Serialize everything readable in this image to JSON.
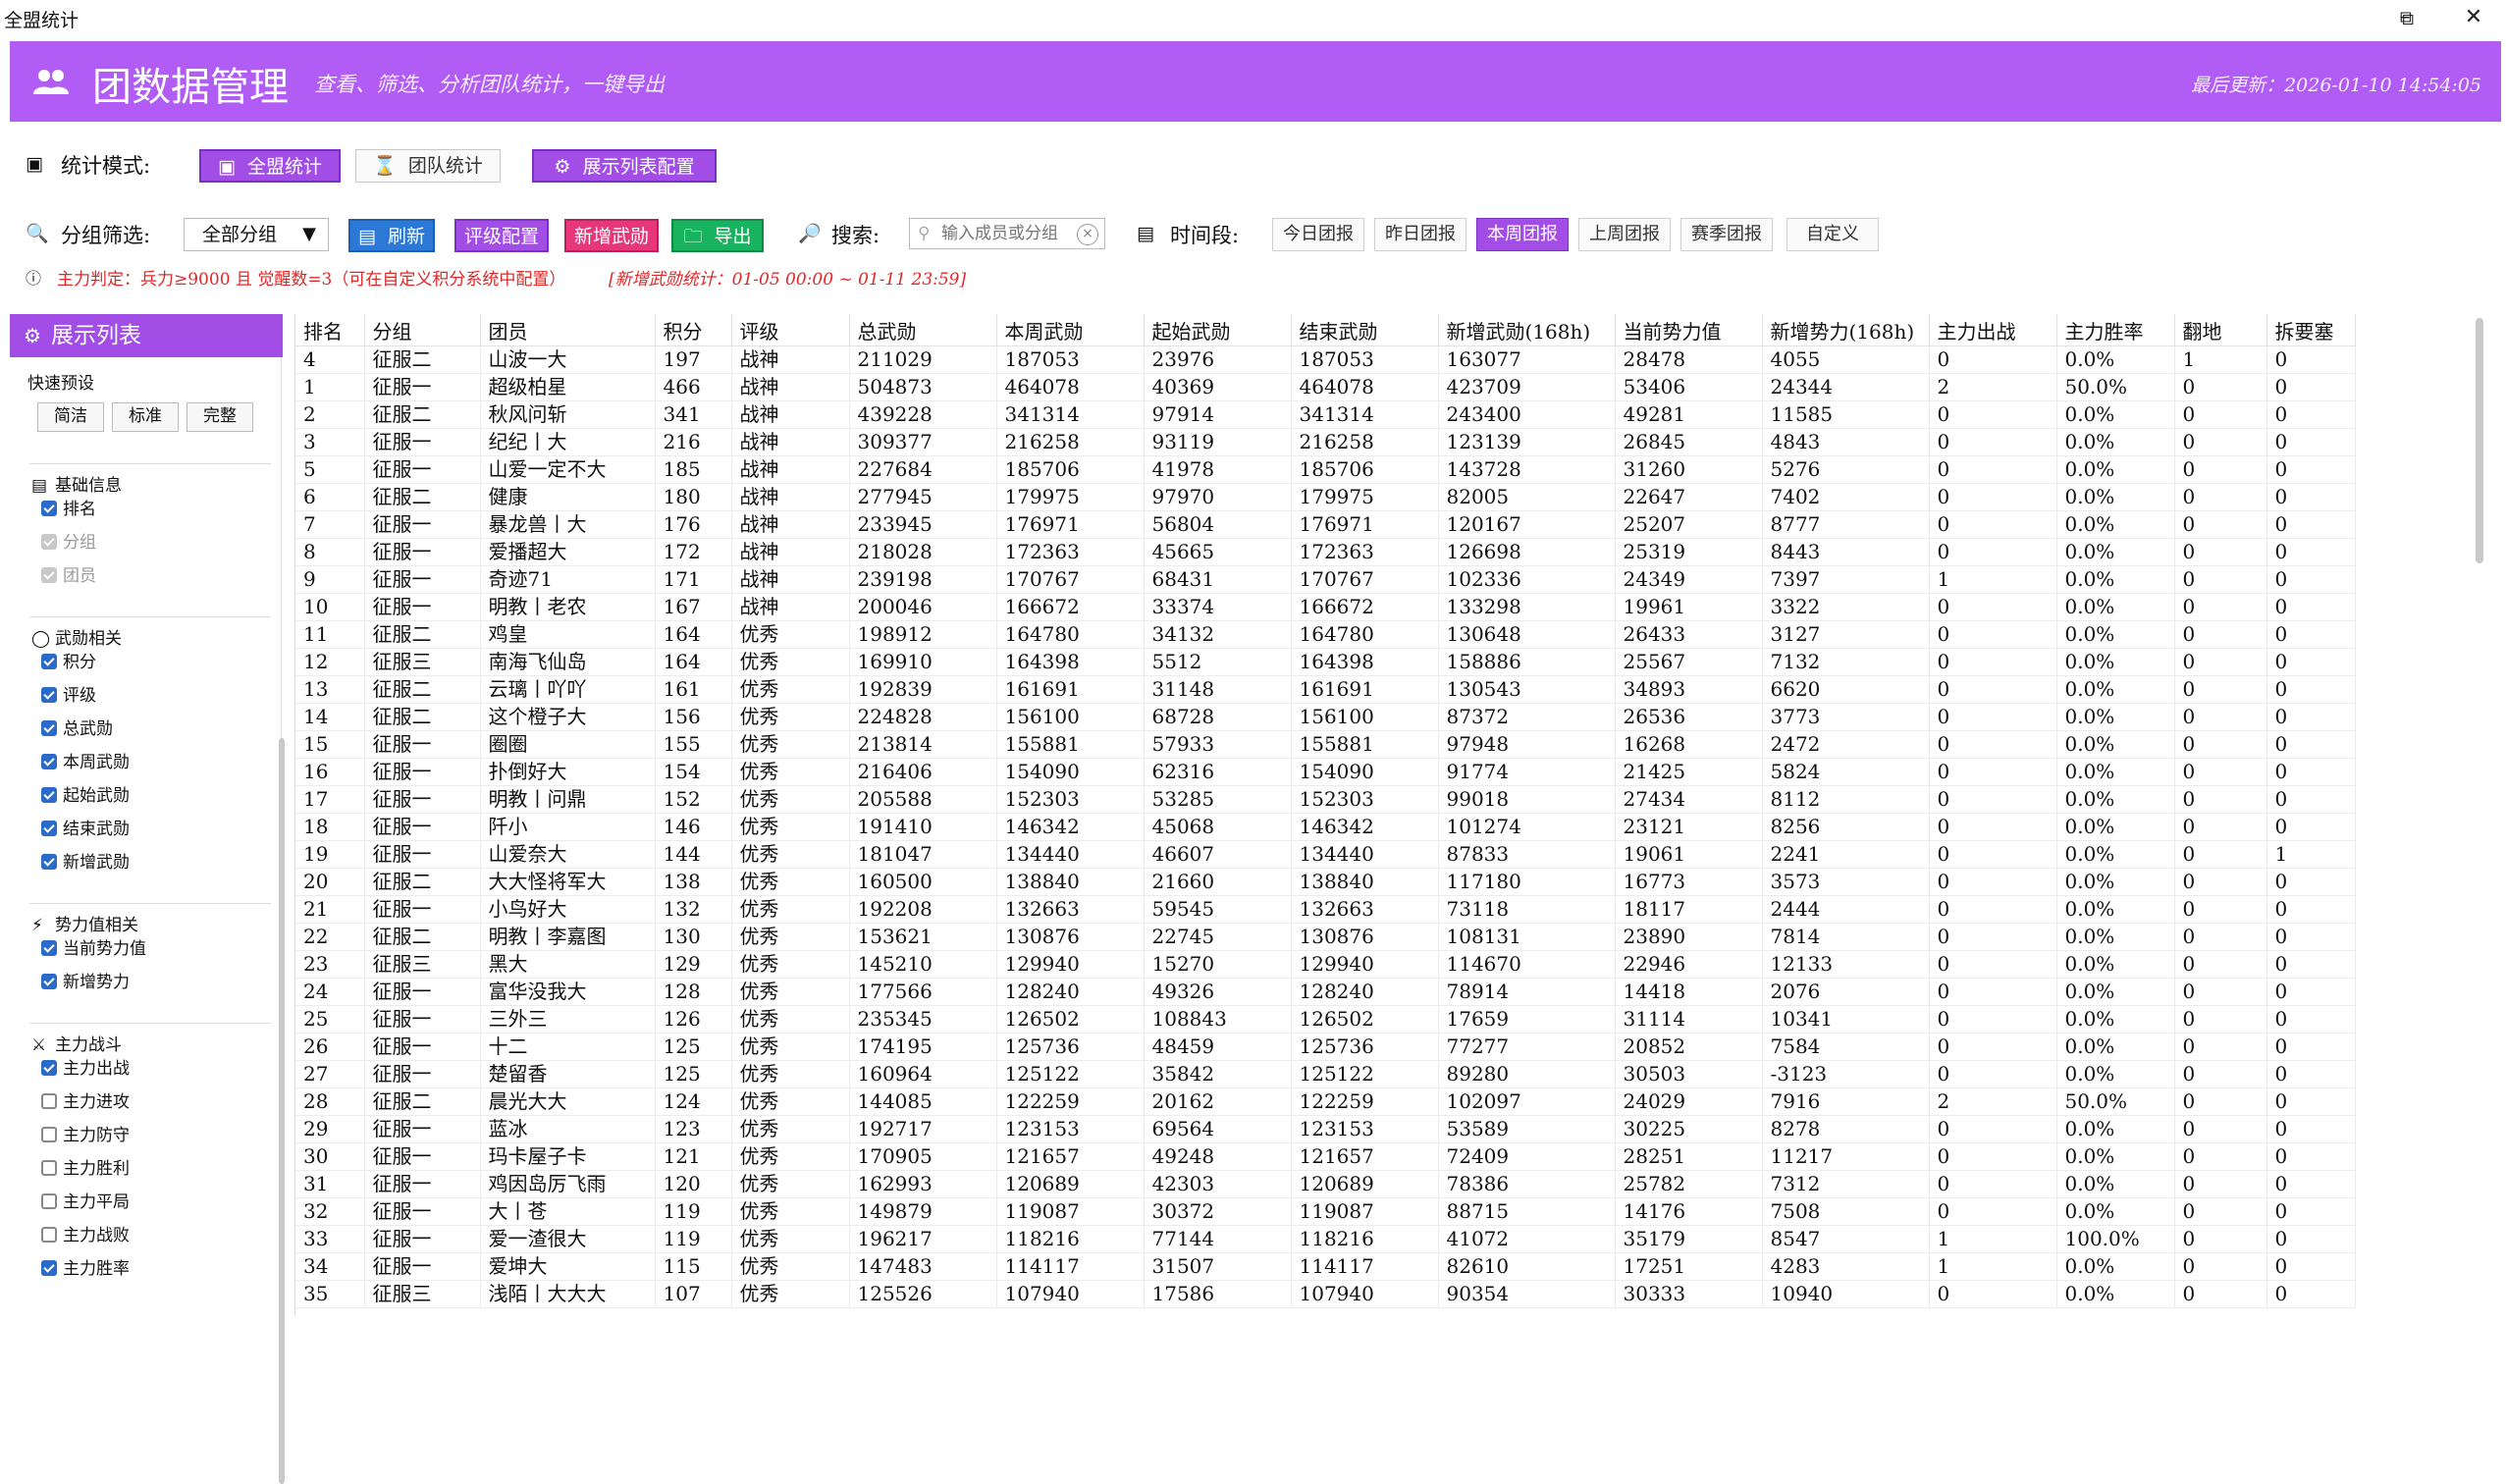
{
  "window": {
    "title": "全盟统计"
  },
  "header": {
    "title": "团数据管理",
    "subtitle": "查看、筛选、分析团队统计，一键导出",
    "last_updated": "最后更新：2026-01-10 14:54:05"
  },
  "mode": {
    "label": "统计模式:",
    "all_stats": "全盟统计",
    "team_stats": "团队统计",
    "display_config": "展示列表配置"
  },
  "filter": {
    "group_label": "分组筛选:",
    "group_value": "全部分组",
    "refresh": "刷新",
    "rating_config": "评级配置",
    "new_merit": "新增武勋",
    "export": "导出",
    "search_label": "搜索:",
    "search_placeholder": "输入成员或分组",
    "time_label": "时间段:",
    "time_options": [
      "今日团报",
      "昨日团报",
      "本周团报",
      "上周团报",
      "赛季团报",
      "自定义"
    ],
    "time_active": "本周团报"
  },
  "note": {
    "main": "主力判定：兵力≥9000 且 觉醒数=3（可在自定义积分系统中配置）",
    "range": "[新增武勋统计：01-05 00:00 ~ 01-11 23:59]"
  },
  "panel": {
    "title": "展示列表",
    "presets_label": "快速预设",
    "presets": [
      "简洁",
      "标准",
      "完整"
    ],
    "sections": [
      {
        "title": "基础信息",
        "items": [
          {
            "label": "排名",
            "state": "on"
          },
          {
            "label": "分组",
            "state": "disabled"
          },
          {
            "label": "团员",
            "state": "disabled"
          }
        ]
      },
      {
        "title": "武勋相关",
        "items": [
          {
            "label": "积分",
            "state": "on"
          },
          {
            "label": "评级",
            "state": "on"
          },
          {
            "label": "总武勋",
            "state": "on"
          },
          {
            "label": "本周武勋",
            "state": "on"
          },
          {
            "label": "起始武勋",
            "state": "on"
          },
          {
            "label": "结束武勋",
            "state": "on"
          },
          {
            "label": "新增武勋",
            "state": "on"
          }
        ]
      },
      {
        "title": "势力值相关",
        "items": [
          {
            "label": "当前势力值",
            "state": "on"
          },
          {
            "label": "新增势力",
            "state": "on"
          }
        ]
      },
      {
        "title": "主力战斗",
        "items": [
          {
            "label": "主力出战",
            "state": "on"
          },
          {
            "label": "主力进攻",
            "state": "off"
          },
          {
            "label": "主力防守",
            "state": "off"
          },
          {
            "label": "主力胜利",
            "state": "off"
          },
          {
            "label": "主力平局",
            "state": "off"
          },
          {
            "label": "主力战败",
            "state": "off"
          },
          {
            "label": "主力胜率",
            "state": "on"
          }
        ]
      }
    ]
  },
  "table": {
    "columns": [
      "排名",
      "分组",
      "团员",
      "积分",
      "评级",
      "总武勋",
      "本周武勋",
      "起始武勋",
      "结束武勋",
      "新增武勋(168h)",
      "当前势力值",
      "新增势力(168h)",
      "主力出战",
      "主力胜率",
      "翻地",
      "拆要塞"
    ],
    "rows": [
      [
        "4",
        "征服二",
        "山波一大",
        "197",
        "战神",
        "211029",
        "187053",
        "23976",
        "187053",
        "163077",
        "28478",
        "4055",
        "0",
        "0.0%",
        "1",
        "0"
      ],
      [
        "1",
        "征服一",
        "超级柏星",
        "466",
        "战神",
        "504873",
        "464078",
        "40369",
        "464078",
        "423709",
        "53406",
        "24344",
        "2",
        "50.0%",
        "0",
        "0"
      ],
      [
        "2",
        "征服二",
        "秋风问斩",
        "341",
        "战神",
        "439228",
        "341314",
        "97914",
        "341314",
        "243400",
        "49281",
        "11585",
        "0",
        "0.0%",
        "0",
        "0"
      ],
      [
        "3",
        "征服一",
        "纪纪丨大",
        "216",
        "战神",
        "309377",
        "216258",
        "93119",
        "216258",
        "123139",
        "26845",
        "4843",
        "0",
        "0.0%",
        "0",
        "0"
      ],
      [
        "5",
        "征服一",
        "山爱一定不大",
        "185",
        "战神",
        "227684",
        "185706",
        "41978",
        "185706",
        "143728",
        "31260",
        "5276",
        "0",
        "0.0%",
        "0",
        "0"
      ],
      [
        "6",
        "征服二",
        "健康",
        "180",
        "战神",
        "277945",
        "179975",
        "97970",
        "179975",
        "82005",
        "22647",
        "7402",
        "0",
        "0.0%",
        "0",
        "0"
      ],
      [
        "7",
        "征服一",
        "暴龙兽丨大",
        "176",
        "战神",
        "233945",
        "176971",
        "56804",
        "176971",
        "120167",
        "25207",
        "8777",
        "0",
        "0.0%",
        "0",
        "0"
      ],
      [
        "8",
        "征服一",
        "爱播超大",
        "172",
        "战神",
        "218028",
        "172363",
        "45665",
        "172363",
        "126698",
        "25319",
        "8443",
        "0",
        "0.0%",
        "0",
        "0"
      ],
      [
        "9",
        "征服一",
        "奇迹71",
        "171",
        "战神",
        "239198",
        "170767",
        "68431",
        "170767",
        "102336",
        "24349",
        "7397",
        "1",
        "0.0%",
        "0",
        "0"
      ],
      [
        "10",
        "征服一",
        "明教丨老农",
        "167",
        "战神",
        "200046",
        "166672",
        "33374",
        "166672",
        "133298",
        "19961",
        "3322",
        "0",
        "0.0%",
        "0",
        "0"
      ],
      [
        "11",
        "征服二",
        "鸡皇",
        "164",
        "优秀",
        "198912",
        "164780",
        "34132",
        "164780",
        "130648",
        "26433",
        "3127",
        "0",
        "0.0%",
        "0",
        "0"
      ],
      [
        "12",
        "征服三",
        "南海飞仙岛",
        "164",
        "优秀",
        "169910",
        "164398",
        "5512",
        "164398",
        "158886",
        "25567",
        "7132",
        "0",
        "0.0%",
        "0",
        "0"
      ],
      [
        "13",
        "征服二",
        "云璃丨吖吖",
        "161",
        "优秀",
        "192839",
        "161691",
        "31148",
        "161691",
        "130543",
        "34893",
        "6620",
        "0",
        "0.0%",
        "0",
        "0"
      ],
      [
        "14",
        "征服二",
        "这个橙子大",
        "156",
        "优秀",
        "224828",
        "156100",
        "68728",
        "156100",
        "87372",
        "26536",
        "3773",
        "0",
        "0.0%",
        "0",
        "0"
      ],
      [
        "15",
        "征服一",
        "圈圈",
        "155",
        "优秀",
        "213814",
        "155881",
        "57933",
        "155881",
        "97948",
        "16268",
        "2472",
        "0",
        "0.0%",
        "0",
        "0"
      ],
      [
        "16",
        "征服一",
        "扑倒好大",
        "154",
        "优秀",
        "216406",
        "154090",
        "62316",
        "154090",
        "91774",
        "21425",
        "5824",
        "0",
        "0.0%",
        "0",
        "0"
      ],
      [
        "17",
        "征服一",
        "明教丨问鼎",
        "152",
        "优秀",
        "205588",
        "152303",
        "53285",
        "152303",
        "99018",
        "27434",
        "8112",
        "0",
        "0.0%",
        "0",
        "0"
      ],
      [
        "18",
        "征服一",
        "阡小",
        "146",
        "优秀",
        "191410",
        "146342",
        "45068",
        "146342",
        "101274",
        "23121",
        "8256",
        "0",
        "0.0%",
        "0",
        "0"
      ],
      [
        "19",
        "征服一",
        "山爱奈大",
        "144",
        "优秀",
        "181047",
        "134440",
        "46607",
        "134440",
        "87833",
        "19061",
        "2241",
        "0",
        "0.0%",
        "0",
        "1"
      ],
      [
        "20",
        "征服二",
        "大大怪将军大",
        "138",
        "优秀",
        "160500",
        "138840",
        "21660",
        "138840",
        "117180",
        "16773",
        "3573",
        "0",
        "0.0%",
        "0",
        "0"
      ],
      [
        "21",
        "征服一",
        "小鸟好大",
        "132",
        "优秀",
        "192208",
        "132663",
        "59545",
        "132663",
        "73118",
        "18117",
        "2444",
        "0",
        "0.0%",
        "0",
        "0"
      ],
      [
        "22",
        "征服二",
        "明教丨李嘉图",
        "130",
        "优秀",
        "153621",
        "130876",
        "22745",
        "130876",
        "108131",
        "23890",
        "7814",
        "0",
        "0.0%",
        "0",
        "0"
      ],
      [
        "23",
        "征服三",
        "黑大",
        "129",
        "优秀",
        "145210",
        "129940",
        "15270",
        "129940",
        "114670",
        "22946",
        "12133",
        "0",
        "0.0%",
        "0",
        "0"
      ],
      [
        "24",
        "征服一",
        "富华没我大",
        "128",
        "优秀",
        "177566",
        "128240",
        "49326",
        "128240",
        "78914",
        "14418",
        "2076",
        "0",
        "0.0%",
        "0",
        "0"
      ],
      [
        "25",
        "征服一",
        "三外三",
        "126",
        "优秀",
        "235345",
        "126502",
        "108843",
        "126502",
        "17659",
        "31114",
        "10341",
        "0",
        "0.0%",
        "0",
        "0"
      ],
      [
        "26",
        "征服一",
        "十二",
        "125",
        "优秀",
        "174195",
        "125736",
        "48459",
        "125736",
        "77277",
        "20852",
        "7584",
        "0",
        "0.0%",
        "0",
        "0"
      ],
      [
        "27",
        "征服一",
        "楚留香",
        "125",
        "优秀",
        "160964",
        "125122",
        "35842",
        "125122",
        "89280",
        "30503",
        "-3123",
        "0",
        "0.0%",
        "0",
        "0"
      ],
      [
        "28",
        "征服二",
        "晨光大大",
        "124",
        "优秀",
        "144085",
        "122259",
        "20162",
        "122259",
        "102097",
        "24029",
        "7916",
        "2",
        "50.0%",
        "0",
        "0"
      ],
      [
        "29",
        "征服一",
        "蓝冰",
        "123",
        "优秀",
        "192717",
        "123153",
        "69564",
        "123153",
        "53589",
        "30225",
        "8278",
        "0",
        "0.0%",
        "0",
        "0"
      ],
      [
        "30",
        "征服一",
        "玛卡屋子卡",
        "121",
        "优秀",
        "170905",
        "121657",
        "49248",
        "121657",
        "72409",
        "28251",
        "11217",
        "0",
        "0.0%",
        "0",
        "0"
      ],
      [
        "31",
        "征服一",
        "鸡因岛厉飞雨",
        "120",
        "优秀",
        "162993",
        "120689",
        "42303",
        "120689",
        "78386",
        "25782",
        "7312",
        "0",
        "0.0%",
        "0",
        "0"
      ],
      [
        "32",
        "征服一",
        "大丨苍",
        "119",
        "优秀",
        "149879",
        "119087",
        "30372",
        "119087",
        "88715",
        "14176",
        "7508",
        "0",
        "0.0%",
        "0",
        "0"
      ],
      [
        "33",
        "征服一",
        "爱一渣很大",
        "119",
        "优秀",
        "196217",
        "118216",
        "77144",
        "118216",
        "41072",
        "35179",
        "8547",
        "1",
        "100.0%",
        "0",
        "0"
      ],
      [
        "34",
        "征服一",
        "爱坤大",
        "115",
        "优秀",
        "147483",
        "114117",
        "31507",
        "114117",
        "82610",
        "17251",
        "4283",
        "1",
        "0.0%",
        "0",
        "0"
      ],
      [
        "35",
        "征服三",
        "浅陌丨大大大",
        "107",
        "优秀",
        "125526",
        "107940",
        "17586",
        "107940",
        "90354",
        "30333",
        "10940",
        "0",
        "0.0%",
        "0",
        "0"
      ]
    ]
  }
}
